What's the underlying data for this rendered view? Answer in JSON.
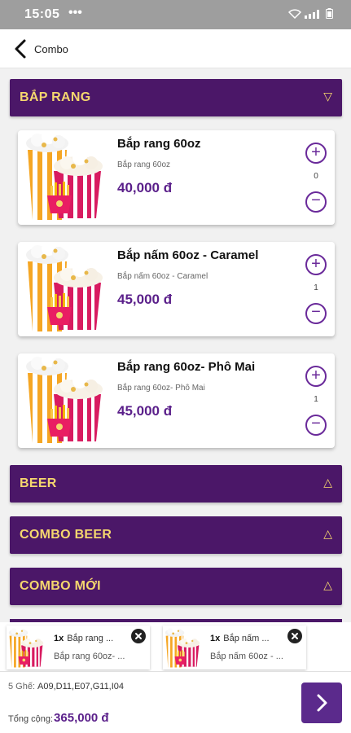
{
  "status_bar": {
    "time": "15:05",
    "dots": "•••"
  },
  "header": {
    "title": "Combo"
  },
  "categories": [
    {
      "label": "BẮP RANG",
      "arrow": "▽"
    },
    {
      "label": "BEER",
      "arrow": "△"
    },
    {
      "label": "COMBO BEER",
      "arrow": "△"
    },
    {
      "label": "COMBO MỚI",
      "arrow": "△"
    }
  ],
  "products": [
    {
      "name": "Bắp rang 60oz",
      "desc": "Bắp rang 60oz",
      "price": "40,000 đ",
      "qty": "0"
    },
    {
      "name": "Bắp nấm 60oz - Caramel",
      "desc": "Bắp nấm 60oz - Caramel",
      "price": "45,000 đ",
      "qty": "1"
    },
    {
      "name": "Bắp rang 60oz- Phô Mai",
      "desc": "Bắp rang 60oz- Phô Mai",
      "price": "45,000 đ",
      "qty": "1"
    }
  ],
  "cart": [
    {
      "qty": "1x",
      "title": "Bắp rang ...",
      "subtitle": "Bắp rang 60oz- ..."
    },
    {
      "qty": "1x",
      "title": "Bắp nấm ...",
      "subtitle": "Bắp nấm 60oz - ..."
    }
  ],
  "summary": {
    "seats_label": "5 Ghế:",
    "seats_value": "A09,D11,E07,G11,I04",
    "total_label": "Tổng cộng:",
    "total_value": "365,000 đ"
  },
  "colors": {
    "brand_purple": "#4b1768",
    "accent_yellow": "#f5d76e",
    "price_purple": "#5a1f8a"
  },
  "icons": [
    "wifi-icon",
    "signal-icon",
    "battery-icon",
    "back-arrow-icon",
    "plus-icon",
    "minus-icon",
    "close-icon",
    "chevron-right-icon",
    "popcorn-image"
  ]
}
